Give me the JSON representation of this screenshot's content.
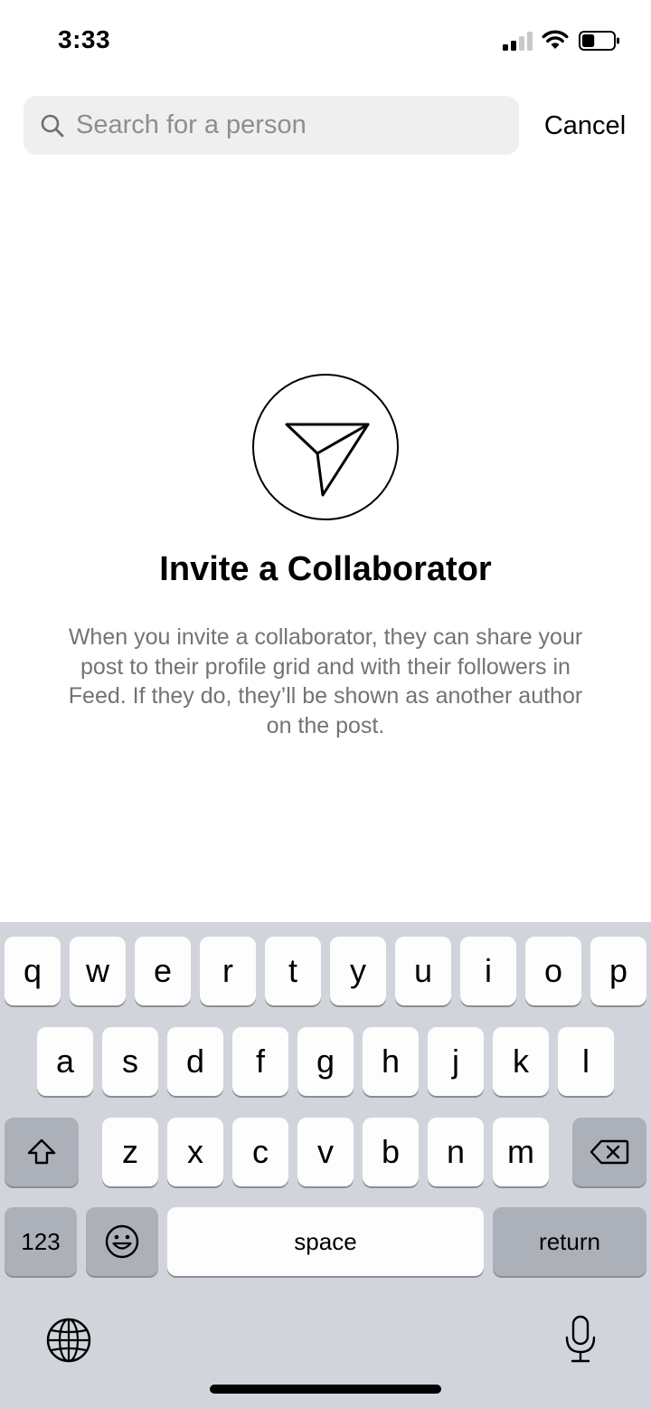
{
  "status_bar": {
    "time": "3:33",
    "signal_icon": "cellular-signal-icon",
    "wifi_icon": "wifi-icon",
    "battery_icon": "battery-icon",
    "battery_level": 0.4
  },
  "search": {
    "placeholder": "Search for a person",
    "value": "",
    "icon": "search-icon",
    "cancel_label": "Cancel"
  },
  "empty_state": {
    "icon": "paper-plane-icon",
    "title": "Invite a Collaborator",
    "description": "When you invite a collaborator, they can share your post to their profile grid and with their followers in Feed. If they do, they’ll be shown as another author on the post."
  },
  "keyboard": {
    "row1": [
      "q",
      "w",
      "e",
      "r",
      "t",
      "y",
      "u",
      "i",
      "o",
      "p"
    ],
    "row2": [
      "a",
      "s",
      "d",
      "f",
      "g",
      "h",
      "j",
      "k",
      "l"
    ],
    "row3": [
      "z",
      "x",
      "c",
      "v",
      "b",
      "n",
      "m"
    ],
    "shift_icon": "shift-icon",
    "delete_icon": "delete-icon",
    "numbers_label": "123",
    "emoji_icon": "emoji-icon",
    "space_label": "space",
    "return_label": "return",
    "globe_icon": "globe-icon",
    "mic_icon": "microphone-icon"
  },
  "colors": {
    "search_bg": "#efefef",
    "placeholder": "#8e8e8e",
    "description_text": "#737373",
    "keyboard_bg": "#d1d4db",
    "key_bg": "#fdfdfe",
    "special_key_bg": "#acb0b9"
  }
}
